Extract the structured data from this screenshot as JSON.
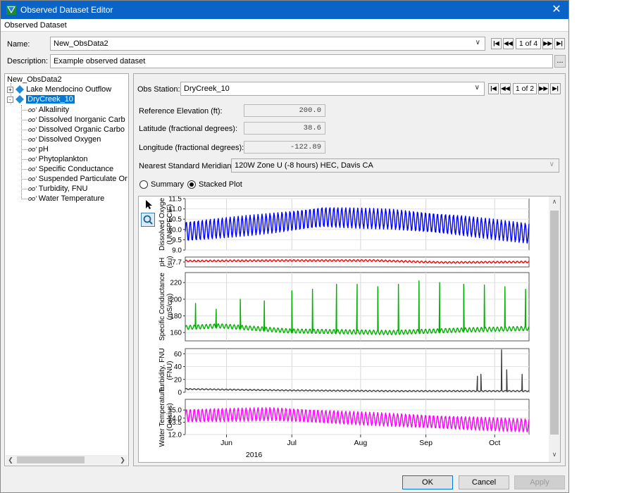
{
  "window": {
    "title": "Observed Dataset Editor",
    "close_glyph": "✕",
    "menu_label": "Observed Dataset"
  },
  "name_row": {
    "label": "Name:",
    "value": "New_ObsData2",
    "pager": "1 of 4"
  },
  "description_row": {
    "label": "Description:",
    "value": "Example observed dataset",
    "browse_label": "..."
  },
  "tree": {
    "root": "New_ObsData2",
    "stations": [
      {
        "label": "Lake Mendocino Outflow",
        "expander": "+"
      },
      {
        "label": "DryCreek_10",
        "expander": "-",
        "selected": true
      }
    ],
    "parameters": [
      "Alkalinity",
      "Dissolved Inorganic Carb",
      "Dissolved Organic Carbo",
      "Dissolved Oxygen",
      "pH",
      "Phytoplankton",
      "Specific Conductance",
      "Suspended Particulate Or",
      "Turbidity, FNU",
      "Water Temperature"
    ],
    "param_icon": "οο'"
  },
  "station": {
    "label": "Obs Station:",
    "value": "DryCreek_10",
    "pager": "1 of 2"
  },
  "properties": [
    {
      "label": "Reference Elevation (ft):",
      "value": "200.0"
    },
    {
      "label": "Latitude (fractional degrees):",
      "value": "38.6"
    },
    {
      "label": "Longitude (fractional degrees):",
      "value": "-122.89"
    }
  ],
  "meridian": {
    "label": "Nearest Standard Meridian:",
    "value": "120W Zone U (-8 hours) HEC, Davis CA"
  },
  "view_mode": {
    "options": [
      "Summary",
      "Stacked Plot"
    ],
    "selected": "Stacked Plot"
  },
  "colors": {
    "accent": "#0078d7",
    "oxygen": "#0000ff",
    "ph": "#ff0000",
    "conductance": "#00b000",
    "turbidity": "#404040",
    "temperature": "#ff00ff"
  },
  "chart_data": {
    "type": "line",
    "x_ticks": [
      "Jun",
      "Jul",
      "Aug",
      "Sep",
      "Oct"
    ],
    "x_year": "2016",
    "panels": [
      {
        "ylabel": [
          "Dissolved Oxyge",
          "(UNSPECIF)"
        ],
        "ylim": [
          9.0,
          11.5
        ],
        "yticks": [
          "11.5",
          "11.0",
          "10.5",
          "10.0",
          "9.5",
          "9.0"
        ],
        "tick_values": [
          11.5,
          11.0,
          10.5,
          10.0,
          9.5,
          9.0
        ],
        "series": {
          "color_key": "oxygen",
          "trend": [
            [
              0,
              9.9
            ],
            [
              0.25,
              10.3
            ],
            [
              0.4,
              10.6
            ],
            [
              0.6,
              10.5
            ],
            [
              0.8,
              10.2
            ],
            [
              1,
              9.8
            ]
          ],
          "amplitude": 0.55
        }
      },
      {
        "ylabel": [
          "pH",
          "(su)"
        ],
        "ylim": [
          7.6,
          7.8
        ],
        "yticks": [
          "7.7"
        ],
        "tick_values": [
          7.7
        ],
        "series": {
          "color_key": "ph",
          "trend": [
            [
              0,
              7.72
            ],
            [
              0.3,
              7.73
            ],
            [
              0.55,
              7.73
            ],
            [
              0.75,
              7.69
            ],
            [
              1,
              7.7
            ]
          ],
          "amplitude": 0.02
        }
      },
      {
        "ylabel": [
          "Specific Conductance",
          "(mS/cm)"
        ],
        "ylim": [
          150,
          232
        ],
        "yticks": [
          "220",
          "200",
          "180",
          "160"
        ],
        "tick_values": [
          220,
          200,
          180,
          160
        ],
        "series": {
          "color_key": "conductance",
          "trend": [
            [
              0,
              166
            ],
            [
              0.1,
              168
            ],
            [
              0.3,
              162
            ],
            [
              0.6,
              160
            ],
            [
              0.8,
              163
            ],
            [
              1,
              165
            ]
          ],
          "amplitude": 3,
          "spikes": [
            [
              0.03,
              195
            ],
            [
              0.09,
              188
            ],
            [
              0.16,
              200
            ],
            [
              0.23,
              198
            ],
            [
              0.31,
              210
            ],
            [
              0.37,
              212
            ],
            [
              0.44,
              218
            ],
            [
              0.5,
              218
            ],
            [
              0.56,
              215
            ],
            [
              0.62,
              218
            ],
            [
              0.68,
              222
            ],
            [
              0.74,
              220
            ],
            [
              0.81,
              218
            ],
            [
              0.87,
              217
            ],
            [
              0.93,
              215
            ],
            [
              0.99,
              212
            ]
          ]
        }
      },
      {
        "ylabel": [
          "Turbidity, FNU",
          "(FNU)"
        ],
        "ylim": [
          0,
          68
        ],
        "yticks": [
          "60",
          "40",
          "20",
          "0"
        ],
        "tick_values": [
          60,
          40,
          20,
          0
        ],
        "series": {
          "color_key": "turbidity",
          "trend": [
            [
              0,
              5
            ],
            [
              0.3,
              3
            ],
            [
              0.6,
              2
            ],
            [
              1,
              2
            ]
          ],
          "amplitude": 1,
          "spikes": [
            [
              0.85,
              25
            ],
            [
              0.86,
              28
            ],
            [
              0.92,
              66
            ],
            [
              0.935,
              35
            ],
            [
              0.98,
              28
            ]
          ]
        }
      },
      {
        "ylabel": [
          "Water Temperature",
          "(Celsius)"
        ],
        "ylim": [
          12.0,
          16.3
        ],
        "yticks": [
          "15.0",
          "14.0",
          "13.5",
          "12.0"
        ],
        "tick_values": [
          15.0,
          14.0,
          13.5,
          12.0
        ],
        "series": {
          "color_key": "temperature",
          "trend": [
            [
              0,
              14.3
            ],
            [
              0.25,
              14.5
            ],
            [
              0.5,
              14.0
            ],
            [
              0.75,
              13.5
            ],
            [
              1,
              13.1
            ]
          ],
          "amplitude": 0.9
        }
      }
    ]
  },
  "buttons": {
    "ok": "OK",
    "cancel": "Cancel",
    "apply": "Apply"
  }
}
